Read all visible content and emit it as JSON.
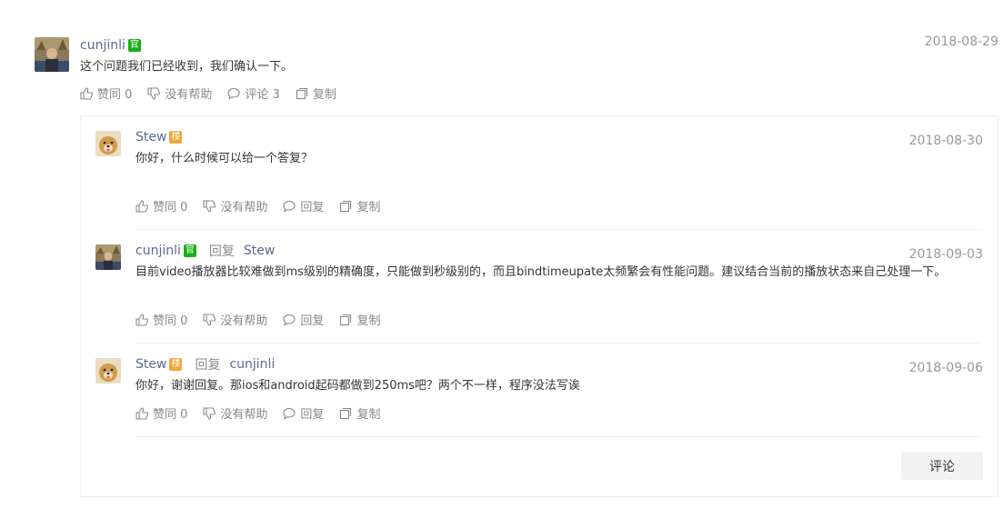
{
  "post": {
    "author": "cunjinli",
    "badge": "官",
    "date": "2018-08-29",
    "text": "这个问题我们已经收到，我们确认一下。",
    "actions": {
      "like": "赞同 0",
      "unhelpful": "没有帮助",
      "comment": "评论 3",
      "copy": "复制"
    }
  },
  "comments": [
    {
      "author": "Stew",
      "badge": "楼",
      "date": "2018-08-30",
      "text": "你好，什么时候可以给一个答复？",
      "actions": {
        "like": "赞同 0",
        "unhelpful": "没有帮助",
        "reply": "回复",
        "copy": "复制"
      }
    },
    {
      "author": "cunjinli",
      "badge": "官",
      "reply_word": "回复",
      "reply_to": "Stew",
      "date": "2018-09-03",
      "text": "目前video播放器比较难做到ms级别的精确度，只能做到秒级别的，而且bindtimeupate太频繁会有性能问题。建议结合当前的播放状态来自己处理一下。",
      "actions": {
        "like": "赞同 0",
        "unhelpful": "没有帮助",
        "reply": "回复",
        "copy": "复制"
      }
    },
    {
      "author": "Stew",
      "badge": "楼",
      "reply_word": "回复",
      "reply_to": "cunjinli",
      "date": "2018-09-06",
      "text": "你好，谢谢回复。那ios和android起码都做到250ms吧？两个不一样，程序没法写诶",
      "actions": {
        "like": "赞同 0",
        "unhelpful": "没有帮助",
        "reply": "回复",
        "copy": "复制"
      }
    }
  ],
  "comment_button": "评论",
  "colors": {
    "name": "#576b95",
    "official_badge": "#1aad19",
    "op_badge": "#f0a63a",
    "meta": "#999999"
  }
}
